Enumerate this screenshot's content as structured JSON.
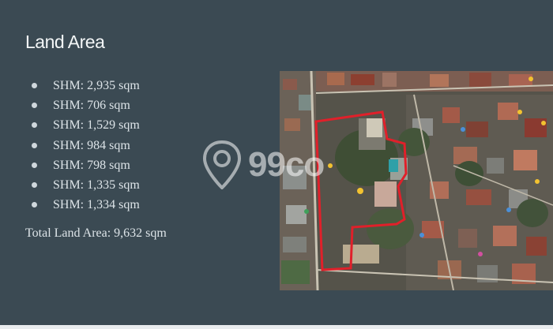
{
  "slide": {
    "title": "Land Area",
    "items": [
      "SHM: 2,935 sqm",
      "SHM: 706 sqm",
      "SHM: 1,529 sqm",
      "SHM: 984 sqm",
      "SHM: 798 sqm",
      "SHM: 1,335 sqm",
      "SHM: 1,334 sqm"
    ],
    "total": "Total Land Area: 9,632 sqm"
  },
  "watermark": {
    "text": "99co",
    "icon": "location-pin-icon",
    "color": "#ffffff"
  },
  "colors": {
    "background": "#3b4a53",
    "boundary": "#e0202a",
    "marker": "#f2c230"
  }
}
